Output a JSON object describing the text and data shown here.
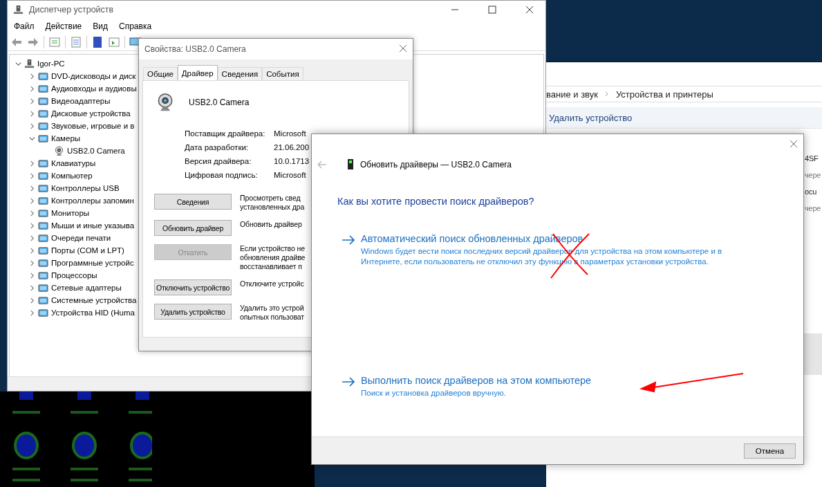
{
  "device_manager": {
    "title": "Диспетчер устройств",
    "menu": [
      "Файл",
      "Действие",
      "Вид",
      "Справка"
    ],
    "tree": {
      "label": "Igor-PC",
      "expanded": true,
      "children": [
        {
          "label": "DVD-дисководы и диск",
          "expanded": false
        },
        {
          "label": "Аудиовходы и аудиовы",
          "expanded": false
        },
        {
          "label": "Видеоадаптеры",
          "expanded": false
        },
        {
          "label": "Дисковые устройства",
          "expanded": false
        },
        {
          "label": "Звуковые, игровые и в",
          "expanded": false
        },
        {
          "label": "Камеры",
          "expanded": true,
          "children": [
            {
              "label": "USB2.0 Camera"
            }
          ]
        },
        {
          "label": "Клавиатуры",
          "expanded": false
        },
        {
          "label": "Компьютер",
          "expanded": false
        },
        {
          "label": "Контроллеры USB",
          "expanded": false
        },
        {
          "label": "Контроллеры запомин",
          "expanded": false
        },
        {
          "label": "Мониторы",
          "expanded": false
        },
        {
          "label": "Мыши и иные указыва",
          "expanded": false
        },
        {
          "label": "Очереди печати",
          "expanded": false
        },
        {
          "label": "Порты (COM и LPT)",
          "expanded": false
        },
        {
          "label": "Программные устройс",
          "expanded": false
        },
        {
          "label": "Процессоры",
          "expanded": false
        },
        {
          "label": "Сетевые адаптеры",
          "expanded": false
        },
        {
          "label": "Системные устройства",
          "expanded": false
        },
        {
          "label": "Устройства HID (Huma",
          "expanded": false
        }
      ]
    }
  },
  "background_window": {
    "breadcrumb": [
      "вание и звук",
      "Устройства и принтеры"
    ],
    "toolbar_action": "Удалить устройство",
    "items": [
      "4SF",
      "чере",
      "ocu",
      "чере"
    ]
  },
  "properties_dialog": {
    "title": "Свойства: USB2.0 Camera",
    "tabs": [
      {
        "label": "Общие",
        "selected": false
      },
      {
        "label": "Драйвер",
        "selected": true
      },
      {
        "label": "Сведения",
        "selected": false
      },
      {
        "label": "События",
        "selected": false
      }
    ],
    "device_name": "USB2.0 Camera",
    "fields": [
      {
        "label": "Поставщик драйвера:",
        "value": "Microsoft"
      },
      {
        "label": "Дата разработки:",
        "value": "21.06.200"
      },
      {
        "label": "Версия драйвера:",
        "value": "10.0.1713"
      },
      {
        "label": "Цифровая подпись:",
        "value": "Microsoft"
      }
    ],
    "actions": [
      {
        "button": "Сведения",
        "disabled": false,
        "description": [
          "Просмотреть свед",
          "установленных дра"
        ]
      },
      {
        "button": "Обновить драйвер",
        "disabled": false,
        "description": [
          "Обновить драйвер"
        ]
      },
      {
        "button": "Откатить",
        "disabled": true,
        "description": [
          "Если устройство не",
          "обновления драйве",
          "восстанавливает п"
        ]
      },
      {
        "button": "Отключить устройство",
        "disabled": false,
        "description": [
          "Отключите устройс"
        ]
      },
      {
        "button": "Удалить устройство",
        "disabled": false,
        "description": [
          "Удалить это устрой",
          "опытных пользоват"
        ]
      }
    ]
  },
  "update_dialog": {
    "title": "Обновить драйверы — USB2.0 Camera",
    "heading": "Как вы хотите провести поиск драйверов?",
    "options": [
      {
        "title": "Автоматический поиск обновленных драйверов",
        "description": "Windows будет вести поиск последних версий драйверов для устройства на этом компьютере и в Интернете, если пользователь не отключил эту функцию в параметрах установки устройства."
      },
      {
        "title": "Выполнить поиск драйверов на этом компьютере",
        "description": "Поиск и установка драйверов вручную."
      }
    ],
    "cancel_button": "Отмена"
  }
}
